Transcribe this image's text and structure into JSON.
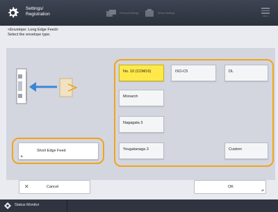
{
  "header": {
    "title_line1": "Settings/",
    "title_line2": "Registration",
    "tabs": [
      {
        "icon": "copy-icon",
        "label": "Personal Settings"
      },
      {
        "icon": "settings-icon",
        "label": "Device Settings"
      }
    ],
    "menu_label": "Menu"
  },
  "instruction": {
    "line1": "<Envelope: Long Edge Feed>",
    "line2": "Select the envelope type."
  },
  "short_edge_feed": {
    "label": "Short Edge Feed"
  },
  "envelopes": [
    {
      "label": "No. 10 (COM10)",
      "selected": true
    },
    {
      "label": "ISO-C5",
      "selected": false
    },
    {
      "label": "DL",
      "selected": false
    },
    {
      "label": "Monarch",
      "selected": false
    },
    {
      "label": "Nagagata 3",
      "selected": false
    },
    {
      "label": "Yougatanaga 3",
      "selected": false
    },
    {
      "label": "Custom",
      "selected": false
    }
  ],
  "footer_buttons": {
    "cancel_label": "Cancel",
    "ok_label": "OK"
  },
  "status_monitor": {
    "label": "Status Monitor"
  },
  "colors": {
    "accent_frame": "#f2a31b",
    "selected": "#ffe94a",
    "header": "#2c313d"
  }
}
